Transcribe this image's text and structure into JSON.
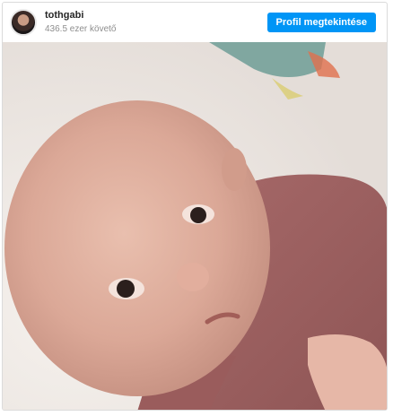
{
  "post": {
    "username": "tothgabi",
    "followers": "436.5 ezer követő",
    "view_profile_label": "Profil megtekintése"
  },
  "colors": {
    "accent": "#0095f6",
    "username": "#262626",
    "muted": "#8e8e8e"
  },
  "image": {
    "icon": "baby-photo"
  }
}
